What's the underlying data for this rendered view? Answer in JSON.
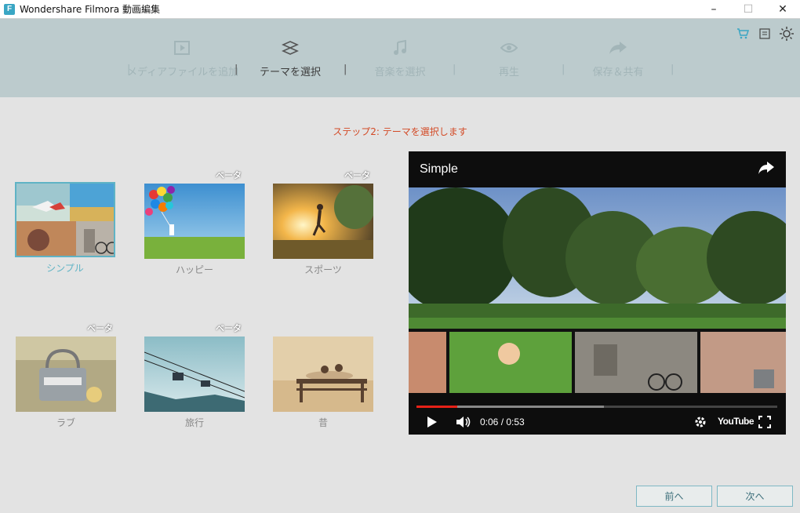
{
  "window": {
    "app_icon": "F",
    "title": "Wondershare Filmora 動画編集",
    "controls": [
      "–",
      "☐",
      "✕"
    ]
  },
  "steps": [
    {
      "label": "メディアファイルを追加",
      "icon": "media-icon",
      "state": "inactive"
    },
    {
      "label": "テーマを選択",
      "icon": "theme-icon",
      "state": "active"
    },
    {
      "label": "音楽を選択",
      "icon": "music-icon",
      "state": "inactive"
    },
    {
      "label": "再生",
      "icon": "eye-icon",
      "state": "inactive"
    },
    {
      "label": "保存＆共有",
      "icon": "share-icon",
      "state": "inactive"
    }
  ],
  "separator": "|",
  "header_tools": [
    "cart-icon",
    "list-icon",
    "brightness-icon"
  ],
  "instruction": "ステップ2: テーマを選択します",
  "themes": [
    {
      "label": "シンプル",
      "beta": "",
      "selected": true
    },
    {
      "label": "ハッピー",
      "beta": "ベータ",
      "selected": false
    },
    {
      "label": "スポーツ",
      "beta": "ベータ",
      "selected": false
    },
    {
      "label": "ラブ",
      "beta": "ベータ",
      "selected": false
    },
    {
      "label": "旅行",
      "beta": "ベータ",
      "selected": false
    },
    {
      "label": "昔",
      "beta": "",
      "selected": false
    }
  ],
  "video": {
    "title": "Simple",
    "time": "0:06 / 0:53",
    "progress_played": 0.113,
    "progress_loaded": 0.52,
    "logo": "YouTube"
  },
  "buttons": {
    "prev": "前へ",
    "next": "次へ"
  },
  "colors": {
    "header_bg": "#bccbcd",
    "accent": "#5fb3c5",
    "instruction": "#d34a26",
    "progress": "#e62117"
  }
}
